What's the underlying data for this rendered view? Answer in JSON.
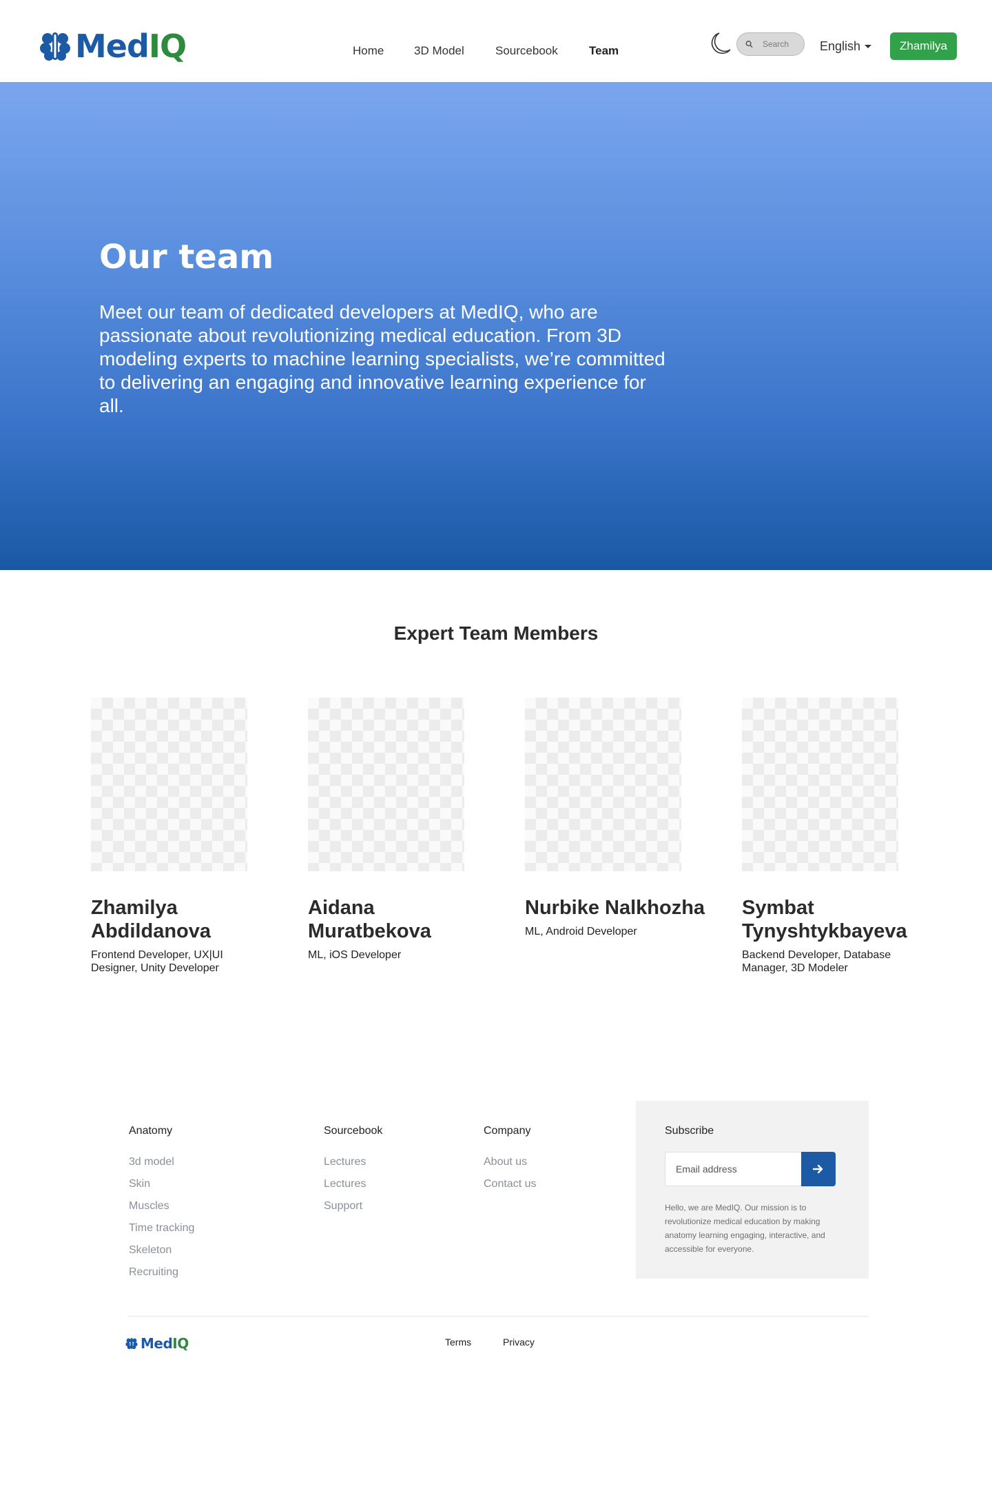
{
  "header": {
    "logo": {
      "med": "Med",
      "iq": "IQ"
    },
    "nav": [
      "Home",
      "3D Model",
      "Sourcebook",
      "Team"
    ],
    "active_nav": "Team",
    "theme_icon": "moon-icon",
    "search": {
      "placeholder": "Search",
      "icon": "search-icon"
    },
    "language": "English",
    "user_button": "Zhamilya",
    "colors": {
      "brand_blue": "#1d5aa6",
      "brand_green": "#2e8b3e",
      "user_button_bg": "#31a249"
    }
  },
  "hero": {
    "title": "Our team",
    "text": "Meet our team of dedicated developers at MedIQ, who are passionate about revolutionizing medical education. From 3D modeling experts to machine learning specialists, we’re committed to delivering an engaging and innovative learning experience for all.",
    "gradient": [
      "#7ba6ee",
      "#1a58a4"
    ]
  },
  "team": {
    "heading": "Expert Team Members",
    "members": [
      {
        "name": "Zhamilya Abdildanova",
        "role": "Frontend Developer, UX|UI Designer, Unity Developer"
      },
      {
        "name": "Aidana Muratbekova",
        "role": "ML, iOS Developer"
      },
      {
        "name": "Nurbike Nalkhozha",
        "role": "ML, Android Developer"
      },
      {
        "name": "Symbat Tynyshtykbayeva",
        "role": "Backend Developer, Database Manager, 3D Modeler"
      }
    ]
  },
  "footer": {
    "columns": [
      {
        "title": "Anatomy",
        "links": [
          "3d model",
          "Skin",
          "Muscles",
          "Time tracking",
          "Skeleton",
          "Recruiting"
        ]
      },
      {
        "title": "Sourcebook",
        "links": [
          "Lectures",
          "Lectures",
          "Support"
        ]
      },
      {
        "title": "Company",
        "links": [
          "About us",
          "Contact us"
        ]
      }
    ],
    "subscribe": {
      "title": "Subscribe",
      "placeholder": "Email address",
      "button_icon": "arrow-right-icon",
      "text": "Hello, we are MedIQ. Our mission is to revolutionize medical education by making anatomy learning engaging, interactive, and accessible for everyone."
    },
    "bottom": {
      "logo": {
        "med": "Med",
        "iq": "IQ"
      },
      "links": [
        "Terms",
        "Privacy"
      ]
    }
  }
}
